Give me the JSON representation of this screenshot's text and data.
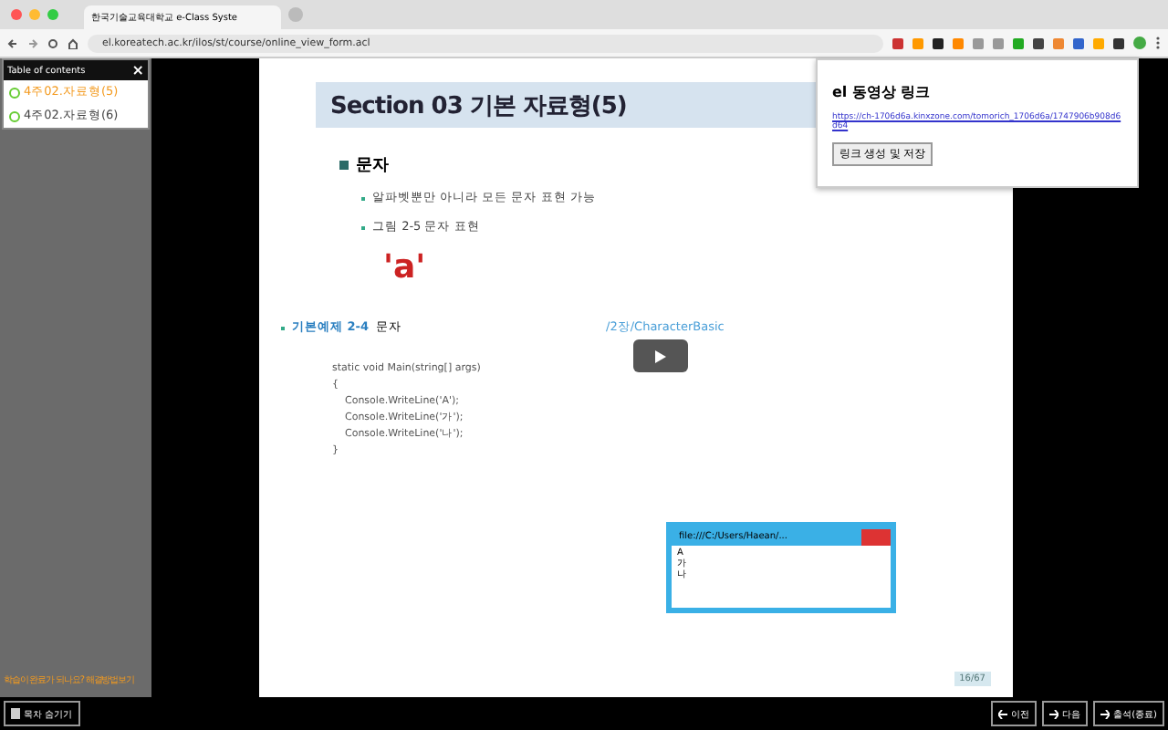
{
  "browser": {
    "tab_title": "한국기술교육대학교 e-Class Syste",
    "url": "el.koreatech.ac.kr/ilos/st/course/online_view_form.acl"
  },
  "toc": {
    "title": "Table of contents",
    "close": "×",
    "items": [
      {
        "label": "4주02.자료형(5)",
        "selected": true
      },
      {
        "label": "4주02.자료형(6)",
        "selected": false
      }
    ],
    "help": "학습이 완료가 되나요? 해결방법보기"
  },
  "popup": {
    "title": "el 동영상 링크",
    "link": "https://ch-1706d6a.kinxzone.com/tomorich_1706d6a/1747906b908d6d64",
    "button": "링크 생성 및 저장"
  },
  "slide": {
    "title": "Section 03 기본 자료형(5)",
    "heading": "문자",
    "bullets": [
      "알파벳뿐만 아니라 모든 문자 표현 가능",
      "그림 2-5 문자 표현"
    ],
    "figure": "'a'",
    "example_label": "기본예제 2-4",
    "example_text": "문자",
    "example_path": "/2장/CharacterBasic",
    "code": [
      "static void Main(string[] args)",
      "{",
      "    Console.WriteLine('A');",
      "    Console.WriteLine('가');",
      "    Console.WriteLine('나');",
      "}"
    ],
    "console": {
      "title": "file:///C:/Users/Haean/...",
      "lines": [
        "A",
        "가",
        "나"
      ]
    },
    "page": "16/67"
  },
  "bottom": {
    "left": "목차 숨기기",
    "buttons": [
      "이전",
      "다음",
      "출석(종료)"
    ]
  }
}
